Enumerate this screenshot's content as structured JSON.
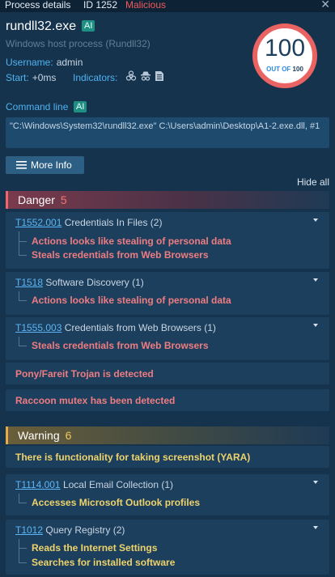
{
  "topbar": {
    "title": "Process details",
    "id": "ID 1252",
    "status": "Malicious",
    "close": "✕"
  },
  "process": {
    "name": "rundll32.exe",
    "ai": "AI",
    "subtitle": "Windows host process (Rundll32)",
    "username_label": "Username:",
    "username": "admin",
    "start_label": "Start:",
    "start": "+0ms",
    "indicators_label": "Indicators:",
    "indicator_icons": [
      "biohazard-icon",
      "spy-icon",
      "document-icon"
    ]
  },
  "score": {
    "value": "100",
    "out_of_label": "OUT OF",
    "max": "100",
    "ring_color": "#ea6363"
  },
  "command": {
    "label": "Command line",
    "ai": "AI",
    "text": "\"C:\\Windows\\System32\\rundll32.exe\" C:\\Users\\admin\\Desktop\\A1-2.exe.dll, #1"
  },
  "more_info": "More Info",
  "hide_all": "Hide all",
  "danger": {
    "title": "Danger",
    "count": "5",
    "color": "#f0676b",
    "groups": [
      {
        "technique": "T1552.001",
        "name": "Credentials In Files (2)",
        "items": [
          "Actions looks like stealing of personal data",
          "Steals credentials from Web Browsers"
        ]
      },
      {
        "technique": "T1518",
        "name": "Software Discovery (1)",
        "items": [
          "Actions looks like stealing of personal data"
        ]
      },
      {
        "technique": "T1555.003",
        "name": "Credentials from Web Browsers (1)",
        "items": [
          "Steals credentials from Web Browsers"
        ]
      }
    ],
    "plain": [
      "Pony/Fareit Trojan is detected",
      "Raccoon mutex has been detected"
    ]
  },
  "warning": {
    "title": "Warning",
    "count": "6",
    "color": "#e7a84a",
    "plain": [
      "There is functionality for taking screenshot (YARA)"
    ],
    "groups": [
      {
        "technique": "T1114.001",
        "name": "Local Email Collection (1)",
        "items": [
          "Accesses Microsoft Outlook profiles"
        ]
      },
      {
        "technique": "T1012",
        "name": "Query Registry (2)",
        "items": [
          "Reads the Internet Settings",
          "Searches for installed software"
        ]
      }
    ]
  }
}
